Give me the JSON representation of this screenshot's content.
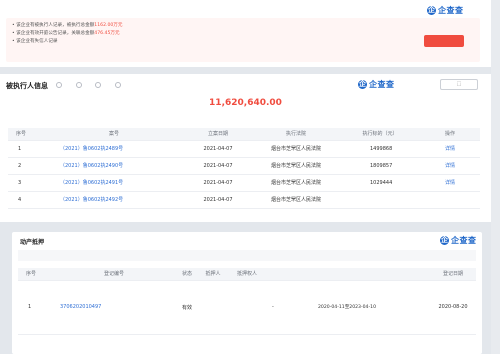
{
  "risk_card": {
    "title": "",
    "title_tag": "",
    "lines": [
      {
        "prefix": "该企业有被执行人记录",
        "mid": "，被执行总金额",
        "value": "1162.00万元"
      },
      {
        "prefix": "该企业有效开庭公告记录",
        "mid": "，关联总金额",
        "value": "476.45万元"
      },
      {
        "prefix": "该企业有失信人记录",
        "mid": "",
        "value": ""
      }
    ],
    "action_button": "",
    "brand_circle": "企",
    "brand_text": "企查查"
  },
  "executed_card": {
    "title": "被执行人信息",
    "title_count": "",
    "filters": [
      "",
      "",
      "",
      ""
    ],
    "badge": "",
    "brand_circle": "企",
    "brand_text": "企查查",
    "export_button": "",
    "total_amount": "11,620,640.00",
    "total_caption": "",
    "columns": [
      "序号",
      "案号",
      "立案日期",
      "执行法院",
      "执行标的（元）",
      "操作"
    ],
    "rows": [
      {
        "index": "1",
        "case_no": "（2021）鲁0602执2489号",
        "date": "2021-04-07",
        "court": "烟台市芝罘区人民法院",
        "amount": "1499868",
        "action": "详情"
      },
      {
        "index": "2",
        "case_no": "（2021）鲁0602执2490号",
        "date": "2021-04-07",
        "court": "烟台市芝罘区人民法院",
        "amount": "1809857",
        "action": "详情"
      },
      {
        "index": "3",
        "case_no": "（2021）鲁0602执2491号",
        "date": "2021-04-07",
        "court": "烟台市芝罘区人民法院",
        "amount": "1029444",
        "action": "详情"
      },
      {
        "index": "4",
        "case_no": "（2021）鲁0602执2492号",
        "date": "2021-04-07",
        "court": "烟台市芝罘区人民法院",
        "amount": "",
        "action": ""
      }
    ]
  },
  "mortgage_card": {
    "title": "动产抵押",
    "title_tag": "",
    "subtitle": "",
    "brand_circle": "企",
    "brand_text": "企查查",
    "columns": [
      "序号",
      "登记编号",
      "状态",
      "抵押人",
      "抵押权人",
      "",
      "",
      "",
      "登记日期"
    ],
    "rows": [
      {
        "index": "1",
        "reg_no": "3706202010497",
        "status": "有效",
        "mortgagor": "",
        "mortgagee": "",
        "col6": "-",
        "col7": "2020-04-11至2023-04-10",
        "col8": "",
        "date": "2020-08-20"
      }
    ]
  }
}
